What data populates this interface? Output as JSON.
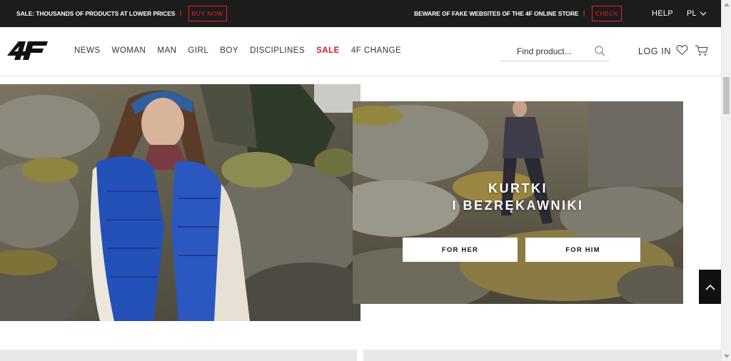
{
  "topbar": {
    "promo_left_text": "SALE: THOUSANDS OF PRODUCTS AT LOWER PRICES",
    "promo_left_excl": "!",
    "promo_left_button": "BUY NOW",
    "promo_right_text": "BEWARE OF FAKE WEBSITES OF THE 4F ONLINE STORE",
    "promo_right_excl": "!",
    "promo_right_button": "CHECK",
    "help_label": "HELP",
    "language": "PL"
  },
  "header": {
    "logo_text": "4F",
    "nav": [
      {
        "label": "NEWS"
      },
      {
        "label": "WOMAN"
      },
      {
        "label": "MAN"
      },
      {
        "label": "GIRL"
      },
      {
        "label": "BOY"
      },
      {
        "label": "DISCIPLINES"
      },
      {
        "label": "SALE"
      },
      {
        "label": "4F CHANGE"
      }
    ],
    "search_placeholder": "Find product...",
    "login_label": "LOG IN"
  },
  "banner": {
    "title_line1": "KURTKI",
    "title_line2": "I BEZRĘKAWNIKI",
    "button_her": "FOR HER",
    "button_him": "FOR HIM"
  },
  "colors": {
    "accent_red": "#e8212b",
    "topbar_bg": "#1c1c1c"
  }
}
